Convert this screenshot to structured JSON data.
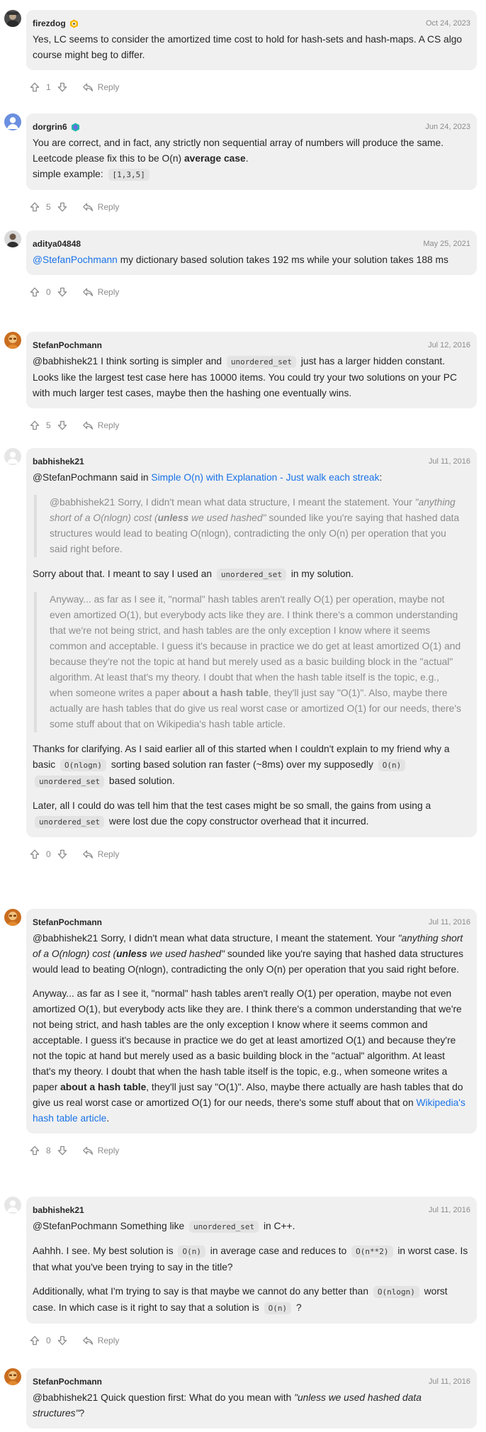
{
  "comments": [
    {
      "username": "firezdog",
      "date": "Oct 24, 2023",
      "badge": "gold",
      "avatar": "photo-dark",
      "votes": "1",
      "reply_label": "Reply",
      "blocks": [
        {
          "t": "p",
          "c": [
            [
              "t",
              "Yes, LC seems to consider the amortized time cost to hold for hash-sets and hash-maps. A CS algo course might beg to differ."
            ]
          ]
        }
      ]
    },
    {
      "username": "dorgrin6",
      "date": "Jun 24, 2023",
      "badge": "teal",
      "avatar": "default-blue",
      "votes": "5",
      "reply_label": "Reply",
      "blocks": [
        {
          "t": "p",
          "c": [
            [
              "t",
              "You are correct, and in fact, any strictly non sequential array of numbers will produce the same. Leetcode please fix this to be O(n) "
            ],
            [
              "b",
              "average case"
            ],
            [
              "t",
              ".\n"
            ],
            [
              "t",
              "simple example: "
            ],
            [
              "c",
              "[1,3,5]"
            ]
          ]
        }
      ]
    },
    {
      "username": "aditya04848",
      "date": "May 25, 2021",
      "badge": "",
      "avatar": "photo-gray",
      "votes": "0",
      "reply_label": "Reply",
      "blocks": [
        {
          "t": "p",
          "c": [
            [
              "a",
              "@StefanPochmann"
            ],
            [
              "t",
              " my dictionary based solution takes 192 ms while your solution takes 188 ms"
            ]
          ]
        }
      ]
    },
    {
      "username": "StefanPochmann",
      "date": "Jul 12, 2016",
      "badge": "",
      "avatar": "photo-orange",
      "votes": "5",
      "reply_label": "Reply",
      "blocks": [
        {
          "t": "p",
          "c": [
            [
              "t",
              "@babhishek21 I think sorting is simpler and "
            ],
            [
              "c",
              "unordered_set"
            ],
            [
              "t",
              " just has a larger hidden constant. Looks like the largest test case here has 10000 items. You could try your two solutions on your PC with much larger test cases, maybe then the hashing one eventually wins."
            ]
          ]
        }
      ]
    },
    {
      "username": "babhishek21",
      "date": "Jul 11, 2016",
      "badge": "",
      "avatar": "default-gray",
      "votes": "0",
      "reply_label": "Reply",
      "blocks": [
        {
          "t": "p",
          "c": [
            [
              "t",
              "@StefanPochmann said in "
            ],
            [
              "a",
              "Simple O(n) with Explanation - Just walk each streak"
            ],
            [
              "t",
              ":"
            ]
          ]
        },
        {
          "t": "q",
          "c": [
            [
              "t",
              "@babhishek21 Sorry, I didn't mean what data structure, I meant the statement. Your "
            ],
            [
              "i",
              "\"anything short of a O(nlogn) cost ("
            ],
            [
              "bi",
              "unless"
            ],
            [
              "i",
              " we used hashed\""
            ],
            [
              "t",
              " sounded like you're saying that hashed data structures would lead to beating O(nlogn), contradicting the only O(n) per operation that you said right before."
            ]
          ]
        },
        {
          "t": "p",
          "c": [
            [
              "t",
              "Sorry about that. I meant to say I used an "
            ],
            [
              "c",
              "unordered_set"
            ],
            [
              "t",
              " in my solution."
            ]
          ]
        },
        {
          "t": "q",
          "c": [
            [
              "t",
              "Anyway... as far as I see it, \"normal\" hash tables aren't really O(1) per operation, maybe not even amortized O(1), but everybody acts like they are. I think there's a common understanding that we're not being strict, and hash tables are the only exception I know where it seems common and acceptable. I guess it's because in practice we do get at least amortized O(1) and because they're not the topic at hand but merely used as a basic building block in the \"actual\" algorithm. At least that's my theory. I doubt that when the hash table itself is the topic, e.g., when someone writes a paper "
            ],
            [
              "b",
              "about a hash table"
            ],
            [
              "t",
              ", they'll just say \"O(1)\". Also, maybe there actually are hash tables that do give us real worst case or amortized O(1) for our needs, there's some stuff about that on Wikipedia's hash table article."
            ]
          ]
        },
        {
          "t": "p",
          "c": [
            [
              "t",
              "Thanks for clarifying. As I said earlier all of this started when I couldn't explain to my friend why a basic "
            ],
            [
              "c",
              "O(nlogn)"
            ],
            [
              "t",
              " sorting based solution ran faster (~8ms) over my supposedly "
            ],
            [
              "c",
              "O(n)"
            ],
            [
              "t",
              " "
            ],
            [
              "c",
              "unordered_set"
            ],
            [
              "t",
              " based solution."
            ]
          ]
        },
        {
          "t": "p",
          "c": [
            [
              "t",
              "Later, all I could do was tell him that the test cases might be so small, the gains from using a "
            ],
            [
              "c",
              "unordered_set"
            ],
            [
              "t",
              " were lost due the copy constructor overhead that it incurred."
            ]
          ]
        }
      ]
    },
    {
      "username": "StefanPochmann",
      "date": "Jul 11, 2016",
      "badge": "",
      "avatar": "photo-orange",
      "votes": "8",
      "reply_label": "Reply",
      "blocks": [
        {
          "t": "p",
          "c": [
            [
              "t",
              "@babhishek21 Sorry, I didn't mean what data structure, I meant the statement. Your "
            ],
            [
              "i",
              "\"anything short of a O(nlogn) cost ("
            ],
            [
              "bi",
              "unless"
            ],
            [
              "i",
              " we used hashed\""
            ],
            [
              "t",
              " sounded like you're saying that hashed data structures would lead to beating O(nlogn), contradicting the only O(n) per operation that you said right before."
            ]
          ]
        },
        {
          "t": "p",
          "c": [
            [
              "t",
              "Anyway... as far as I see it, \"normal\" hash tables aren't really O(1) per operation, maybe not even amortized O(1), but everybody acts like they are. I think there's a common understanding that we're not being strict, and hash tables are the only exception I know where it seems common and acceptable. I guess it's because in practice we do get at least amortized O(1) and because they're not the topic at hand but merely used as a basic building block in the \"actual\" algorithm. At least that's my theory. I doubt that when the hash table itself is the topic, e.g., when someone writes a paper "
            ],
            [
              "b",
              "about a hash table"
            ],
            [
              "t",
              ", they'll just say \"O(1)\". Also, maybe there actually are hash tables that do give us real worst case or amortized O(1) for our needs, there's some stuff about that on "
            ],
            [
              "a",
              "Wikipedia's hash table article"
            ],
            [
              "t",
              "."
            ]
          ]
        }
      ]
    },
    {
      "username": "babhishek21",
      "date": "Jul 11, 2016",
      "badge": "",
      "avatar": "default-gray",
      "votes": "0",
      "reply_label": "Reply",
      "blocks": [
        {
          "t": "p",
          "c": [
            [
              "t",
              "@StefanPochmann Something like "
            ],
            [
              "c",
              "unordered_set"
            ],
            [
              "t",
              " in C++."
            ]
          ]
        },
        {
          "t": "p",
          "c": [
            [
              "t",
              "Aahhh. I see. My best solution is "
            ],
            [
              "c",
              "O(n)"
            ],
            [
              "t",
              " in average case and reduces to "
            ],
            [
              "c",
              "O(n**2)"
            ],
            [
              "t",
              " in worst case. Is that what you've been trying to say in the title?"
            ]
          ]
        },
        {
          "t": "p",
          "c": [
            [
              "t",
              "Additionally, what I'm trying to say is that maybe we cannot do any better than "
            ],
            [
              "c",
              "O(nlogn)"
            ],
            [
              "t",
              " worst case. In which case is it right to say that a solution is "
            ],
            [
              "c",
              "O(n)"
            ],
            [
              "t",
              " ?"
            ]
          ]
        }
      ]
    },
    {
      "username": "StefanPochmann",
      "date": "Jul 11, 2016",
      "badge": "",
      "avatar": "photo-orange",
      "votes": "",
      "reply_label": "",
      "blocks": [
        {
          "t": "p",
          "c": [
            [
              "t",
              "@babhishek21 Quick question first: What do you mean with "
            ],
            [
              "i",
              "\"unless we used hashed data structures\""
            ],
            [
              "t",
              "?"
            ]
          ]
        }
      ]
    }
  ],
  "colors": {
    "link": "#1a73e8",
    "bubble": "#f0f0f0",
    "muted": "#8c8c8c"
  }
}
